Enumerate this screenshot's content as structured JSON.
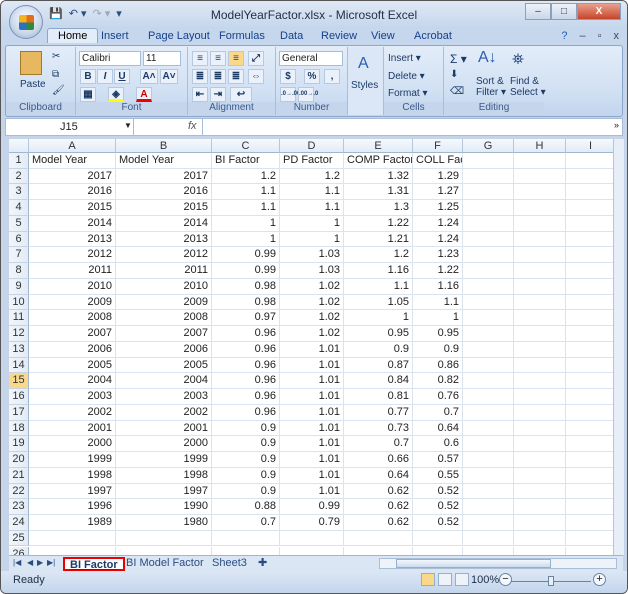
{
  "window": {
    "title": "ModelYearFactor.xlsx - Microsoft Excel",
    "minimize": "–",
    "maximize": "□",
    "close": "X"
  },
  "qat": {
    "save": "💾",
    "undo": "↶ ▾",
    "redo": "↷ ▾",
    "customize": "▾"
  },
  "ribbon_tabs": [
    "Home",
    "Insert",
    "Page Layout",
    "Formulas",
    "Data",
    "Review",
    "View",
    "Acrobat"
  ],
  "ribbon": {
    "clipboard": {
      "label": "Clipboard",
      "paste": "Paste"
    },
    "font": {
      "label": "Font",
      "name": "Calibri",
      "size": "11",
      "bold": "B",
      "italic": "I",
      "underline": "U",
      "grow": "A˄",
      "shrink": "A˅",
      "color": "A"
    },
    "alignment": {
      "label": "Alignment"
    },
    "number": {
      "label": "Number",
      "format": "General",
      "currency": "$",
      "percent": "%",
      "comma": ",",
      "inc_decimal": ".0→.00",
      "dec_decimal": ".00→.0"
    },
    "styles": {
      "label": "Styles"
    },
    "cells": {
      "label": "Cells",
      "insert": "Insert ▾",
      "delete": "Delete ▾",
      "format": "Format ▾"
    },
    "editing": {
      "label": "Editing",
      "sum": "Σ ▾",
      "sort": "Sort &",
      "sort2": "Filter ▾",
      "find": "Find &",
      "find2": "Select ▾"
    }
  },
  "formula_bar": {
    "name_box": "J15",
    "fx": "fx",
    "value": ""
  },
  "columns": [
    "A",
    "B",
    "C",
    "D",
    "E",
    "F",
    "G",
    "H",
    "I"
  ],
  "selected_row": 15,
  "header_row": [
    "Model Year",
    "Model Year",
    "BI Factor",
    "PD Factor",
    "COMP Factor",
    "COLL Factor"
  ],
  "rows": [
    [
      "2017",
      "2017",
      "1.2",
      "1.2",
      "1.32",
      "1.29"
    ],
    [
      "2016",
      "2016",
      "1.1",
      "1.1",
      "1.31",
      "1.27"
    ],
    [
      "2015",
      "2015",
      "1.1",
      "1.1",
      "1.3",
      "1.25"
    ],
    [
      "2014",
      "2014",
      "1",
      "1",
      "1.22",
      "1.24"
    ],
    [
      "2013",
      "2013",
      "1",
      "1",
      "1.21",
      "1.24"
    ],
    [
      "2012",
      "2012",
      "0.99",
      "1.03",
      "1.2",
      "1.23"
    ],
    [
      "2011",
      "2011",
      "0.99",
      "1.03",
      "1.16",
      "1.22"
    ],
    [
      "2010",
      "2010",
      "0.98",
      "1.02",
      "1.1",
      "1.16"
    ],
    [
      "2009",
      "2009",
      "0.98",
      "1.02",
      "1.05",
      "1.1"
    ],
    [
      "2008",
      "2008",
      "0.97",
      "1.02",
      "1",
      "1"
    ],
    [
      "2007",
      "2007",
      "0.96",
      "1.02",
      "0.95",
      "0.95"
    ],
    [
      "2006",
      "2006",
      "0.96",
      "1.01",
      "0.9",
      "0.9"
    ],
    [
      "2005",
      "2005",
      "0.96",
      "1.01",
      "0.87",
      "0.86"
    ],
    [
      "2004",
      "2004",
      "0.96",
      "1.01",
      "0.84",
      "0.82"
    ],
    [
      "2003",
      "2003",
      "0.96",
      "1.01",
      "0.81",
      "0.76"
    ],
    [
      "2002",
      "2002",
      "0.96",
      "1.01",
      "0.77",
      "0.7"
    ],
    [
      "2001",
      "2001",
      "0.9",
      "1.01",
      "0.73",
      "0.64"
    ],
    [
      "2000",
      "2000",
      "0.9",
      "1.01",
      "0.7",
      "0.6"
    ],
    [
      "1999",
      "1999",
      "0.9",
      "1.01",
      "0.66",
      "0.57"
    ],
    [
      "1998",
      "1998",
      "0.9",
      "1.01",
      "0.64",
      "0.55"
    ],
    [
      "1997",
      "1997",
      "0.9",
      "1.01",
      "0.62",
      "0.52"
    ],
    [
      "1996",
      "1990",
      "0.88",
      "0.99",
      "0.62",
      "0.52"
    ],
    [
      "1989",
      "1980",
      "0.7",
      "0.79",
      "0.62",
      "0.52"
    ]
  ],
  "row_numbers": [
    "1",
    "2",
    "3",
    "4",
    "5",
    "6",
    "7",
    "8",
    "9",
    "10",
    "11",
    "12",
    "13",
    "14",
    "15",
    "16",
    "17",
    "18",
    "19",
    "20",
    "21",
    "22",
    "23",
    "24",
    "25",
    "26"
  ],
  "sheet_tabs": [
    "BI Factor",
    "BI Model Factor",
    "Sheet3"
  ],
  "active_sheet": "BI Factor",
  "status": {
    "text": "Ready",
    "zoom": "100%"
  }
}
